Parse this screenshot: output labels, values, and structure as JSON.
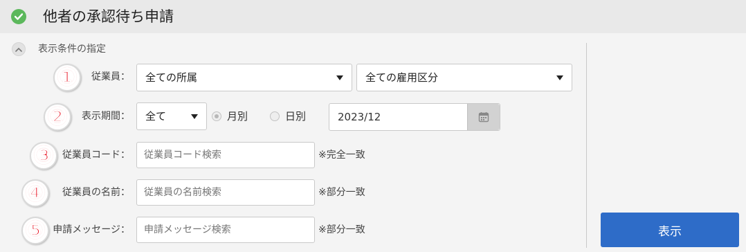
{
  "header": {
    "title": "他者の承認待ち申請",
    "status_icon": "check-circle-icon",
    "status_color": "#5cb85c"
  },
  "filters": {
    "section_title": "表示条件の指定",
    "collapse_icon": "chevron-up-icon",
    "badges": [
      "①",
      "②",
      "③",
      "④",
      "⑤"
    ],
    "badge_color": "#e60012",
    "employee": {
      "label": "従業員：",
      "department_select": "全ての所属",
      "employment_type_select": "全ての雇用区分"
    },
    "period": {
      "label": "表示期間：",
      "period_select": "全て",
      "radio_monthly": "月別",
      "radio_daily": "日別",
      "date_value": "2023/12",
      "calendar_icon": "calendar-icon"
    },
    "employee_code": {
      "label": "従業員コード：",
      "placeholder": "従業員コード検索",
      "hint": "※完全一致"
    },
    "employee_name": {
      "label": "従業員の名前：",
      "placeholder": "従業員の名前検索",
      "hint": "※部分一致"
    },
    "message": {
      "label": "申請メッセージ：",
      "placeholder": "申請メッセージ検索",
      "hint": "※部分一致"
    }
  },
  "actions": {
    "show_button": "表示",
    "show_button_color": "#2e6cc8"
  }
}
